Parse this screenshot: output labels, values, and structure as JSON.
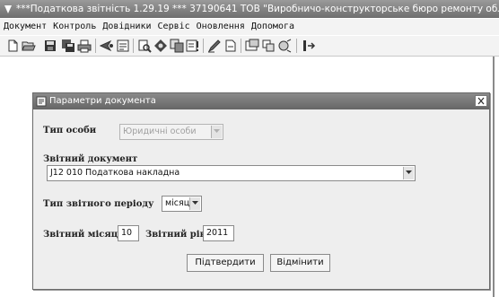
{
  "app": {
    "title": "***Податкова звітність 1.29.19 *** 37190641 ТОВ \"Виробничо-конструкторське бюро ремонту обладнання\""
  },
  "menu": {
    "items": [
      "Документ",
      "Контроль",
      "Довідники",
      "Сервіс",
      "Оновлення",
      "Допомога"
    ]
  },
  "toolbar": {
    "icons": [
      "new-document-icon",
      "open-folder-icon",
      "save-icon",
      "save-all-icon",
      "print-icon",
      "send-icon",
      "report-icon",
      "print-preview-icon",
      "stamp-icon",
      "copy-icon",
      "check-icon",
      "sign-icon",
      "export-icon",
      "settings-icon",
      "windows-icon",
      "globe-icon",
      "exit-icon"
    ]
  },
  "dialog": {
    "title": "Параметри документа",
    "person_type_label": "Тип особи",
    "person_type_value": "Юридичні особи",
    "report_doc_label": "Звітний документ",
    "report_doc_value": "J12 010 Податкова накладна",
    "period_type_label": "Тип звітного періоду",
    "period_type_value": "місяць",
    "month_label": "Звітний місяць",
    "month_value": "10",
    "year_label": "Звітний рік",
    "year_value": "2011",
    "confirm_label": "Підтвердити",
    "cancel_label": "Відмінити"
  }
}
